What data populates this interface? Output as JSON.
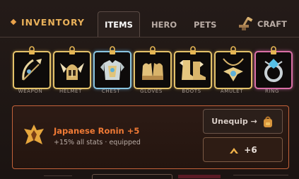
{
  "header": {
    "title": "INVENTORY",
    "tabs": [
      {
        "label": "ITEMS",
        "active": true
      },
      {
        "label": "HERO",
        "active": false
      },
      {
        "label": "PETS",
        "active": false
      },
      {
        "label": "CRAFT",
        "active": false
      }
    ]
  },
  "slots": [
    {
      "label": "WEAPON",
      "icon": "bow-icon",
      "frame": "gold"
    },
    {
      "label": "HELMET",
      "icon": "winged-helmet-icon",
      "frame": "gold"
    },
    {
      "label": "CHEST",
      "icon": "chest-armor-icon",
      "frame": "blue"
    },
    {
      "label": "GLOVES",
      "icon": "gloves-icon",
      "frame": "gold"
    },
    {
      "label": "BOOTS",
      "icon": "boots-icon",
      "frame": "gold"
    },
    {
      "label": "AMULET",
      "icon": "amulet-icon",
      "frame": "gold"
    },
    {
      "label": "RING",
      "icon": "ring-icon",
      "frame": "pink"
    }
  ],
  "selected": {
    "name": "Japanese Ronin +5",
    "detail": "+15% all stats · equipped",
    "unequip_label": "Unequip →",
    "upgrade_value": "+6"
  },
  "colors": {
    "accent": "#f07a35",
    "gold": "#e4c26a",
    "blue": "#8ac5e0",
    "pink": "#d96fa6"
  }
}
